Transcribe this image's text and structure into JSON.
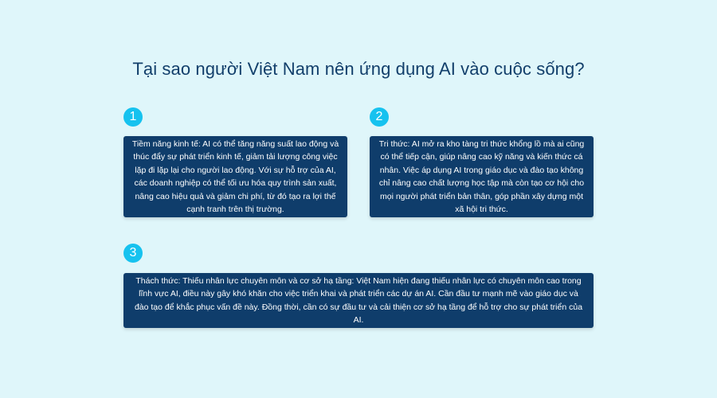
{
  "title": "Tại sao người Việt Nam nên ứng dụng AI vào cuộc sống?",
  "items": [
    {
      "number": "1",
      "text": "Tiềm năng kinh tế: AI có thể tăng năng suất lao động và thúc đẩy sự phát triển kinh tế, giảm tải lượng công việc lặp đi lặp lại cho người lao động. Với sự hỗ trợ của AI, các doanh nghiệp có thể tối ưu hóa quy trình sản xuất, nâng cao hiệu quả và giảm chi phí, từ đó tạo ra lợi thế cạnh tranh trên thị trường."
    },
    {
      "number": "2",
      "text": "Tri thức: AI mở ra kho tàng tri thức khổng lồ mà ai cũng có thể tiếp cận, giúp nâng cao kỹ năng và kiến thức cá nhân. Việc áp dụng AI trong giáo dục và đào tạo không chỉ nâng cao chất lượng học tập mà còn tạo cơ hội cho mọi người phát triển bản thân, góp phần xây dựng một xã hội tri thức."
    },
    {
      "number": "3",
      "text": "Thách thức: Thiếu nhân lực chuyên môn và cơ sở hạ tầng: Việt Nam hiện đang thiếu nhân lực có chuyên môn cao trong lĩnh vực AI, điều này gây khó khăn cho việc triển khai và phát triển các dự án AI. Cần đầu tư mạnh mẽ vào giáo dục và đào tạo để khắc phục vấn đề này. Đồng thời, cần có sự đầu tư và cải thiện cơ sở hạ tầng để hỗ trợ cho sự phát triển của AI."
    }
  ],
  "colors": {
    "background": "#dff6fa",
    "title": "#123f6b",
    "card": "#0f3d6b",
    "badge": "#16c2ef",
    "card_text": "#ffffff"
  }
}
